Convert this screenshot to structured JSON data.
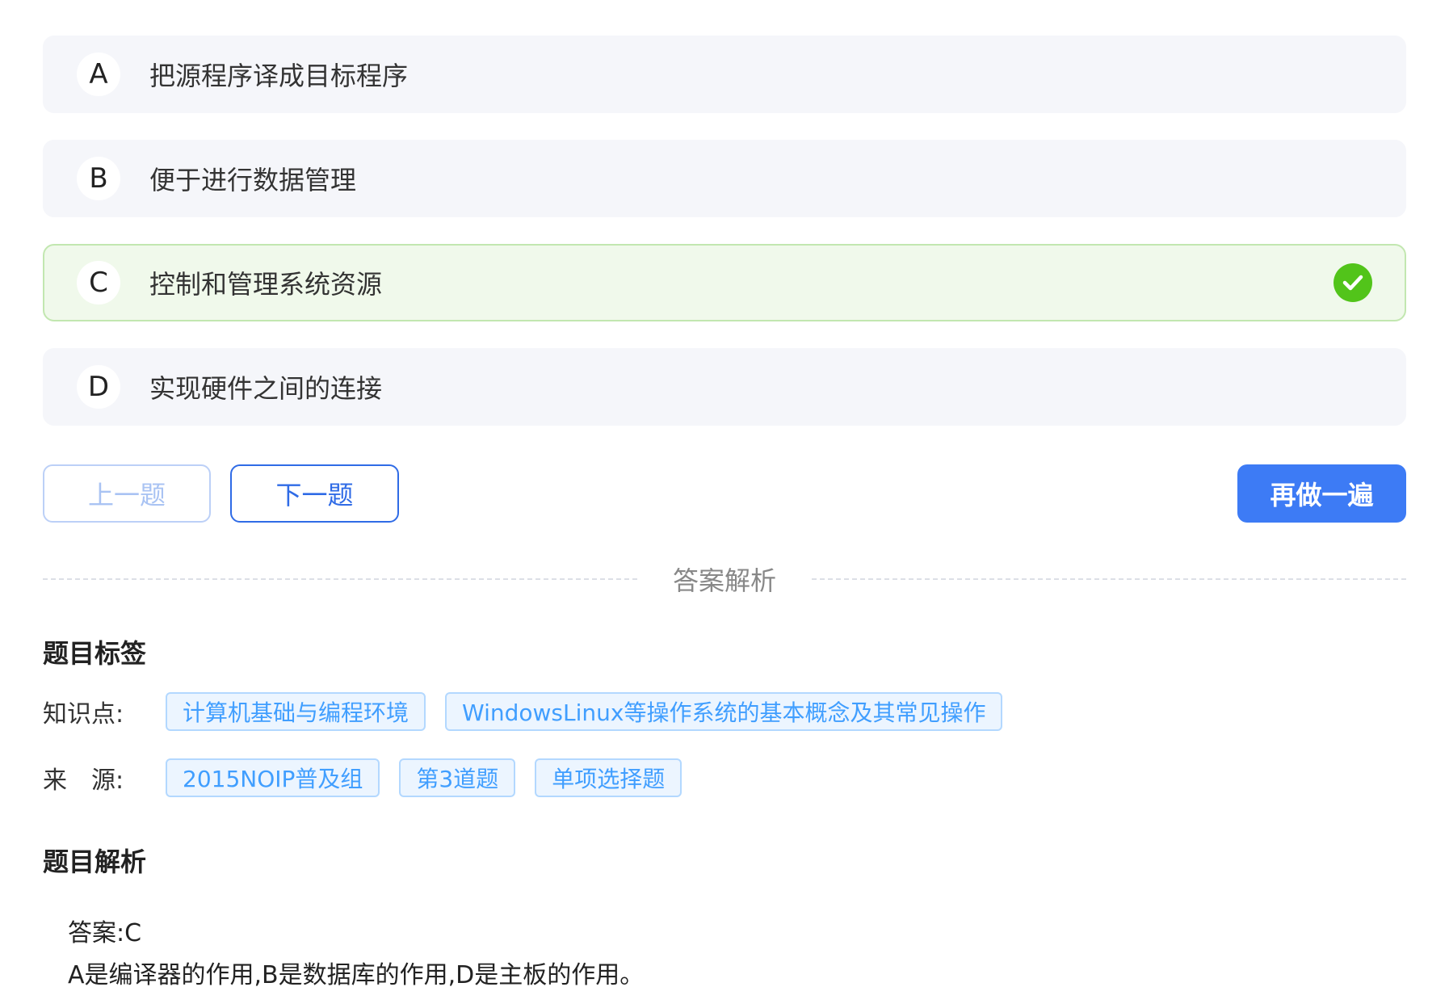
{
  "options": [
    {
      "letter": "A",
      "text": "把源程序译成目标程序",
      "correct": false
    },
    {
      "letter": "B",
      "text": "便于进行数据管理",
      "correct": false
    },
    {
      "letter": "C",
      "text": "控制和管理系统资源",
      "correct": true
    },
    {
      "letter": "D",
      "text": "实现硬件之间的连接",
      "correct": false
    }
  ],
  "nav": {
    "prev_label": "上一题",
    "next_label": "下一题",
    "redo_label": "再做一遍"
  },
  "divider_label": "答案解析",
  "tags_section": {
    "title": "题目标签",
    "knowledge_label": "知识点:",
    "knowledge_tags": [
      "计算机基础与编程环境",
      "WindowsLinux等操作系统的基本概念及其常见操作"
    ],
    "source_label": "来　源:",
    "source_tags": [
      "2015NOIP普及组",
      "第3道题",
      "单项选择题"
    ]
  },
  "analysis_section": {
    "title": "题目解析",
    "answer_line": "答案:C",
    "explanation": "A是编译器的作用,B是数据库的作用,D是主板的作用。"
  },
  "icons": {
    "correct": "check-circle-icon"
  },
  "colors": {
    "correct_bg": "#f0f9eb",
    "correct_border": "#c2e7b0",
    "check_green": "#52c41a",
    "primary_blue": "#3d7bf5",
    "tag_blue": "#409eff"
  }
}
